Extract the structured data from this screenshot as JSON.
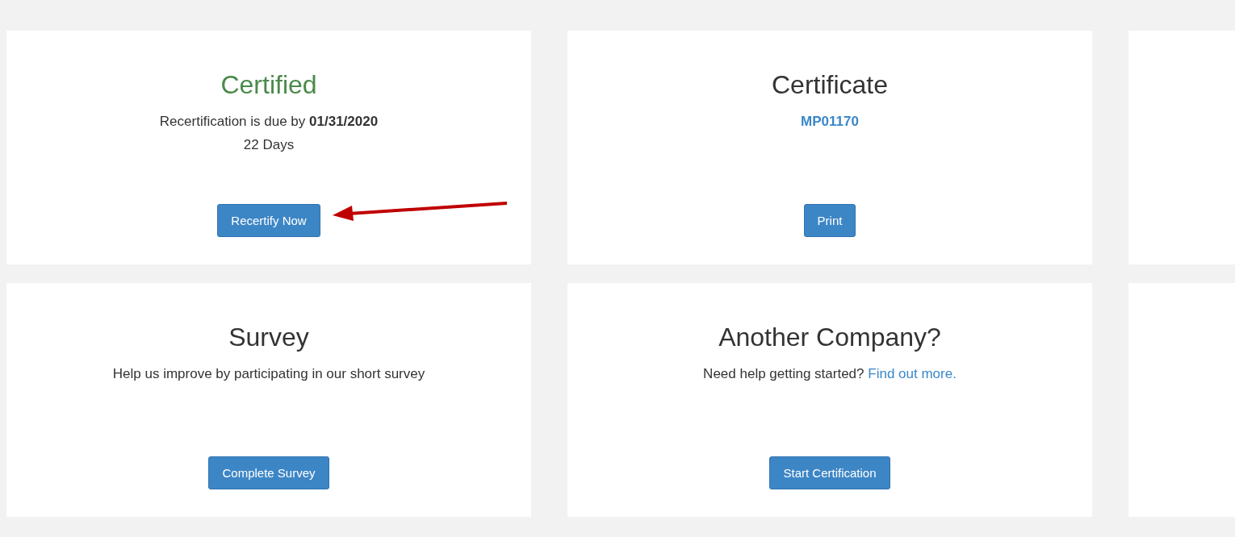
{
  "cards": [
    {
      "kind": "content",
      "title": "Certified",
      "color": "#4a8a4a",
      "lines": [
        {
          "kind": "text",
          "text": "Recertification is due by **01/31/2020**"
        },
        {
          "kind": "text",
          "text": "22 Days"
        }
      ],
      "button": "Recertify Now"
    },
    {
      "kind": "content",
      "title": "Certificate",
      "color": "#333333",
      "lines": [
        {
          "kind": "link",
          "text": "MP01170"
        }
      ],
      "button": "Print"
    },
    {
      "kind": "empty"
    },
    {
      "kind": "content",
      "title": "Survey",
      "color": "#333333",
      "lines": [
        {
          "kind": "text",
          "text": "Help us improve by participating in our short survey"
        }
      ],
      "button": "Complete Survey"
    },
    {
      "kind": "content",
      "title": "Another Company?",
      "color": "#333333",
      "lines": [
        {
          "kind": "text_link",
          "text": "Need help getting started?",
          "link": "Find out more."
        }
      ],
      "button": "Start Certification"
    },
    {
      "kind": "empty"
    }
  ],
  "annotation": {
    "kind": "arrow"
  }
}
